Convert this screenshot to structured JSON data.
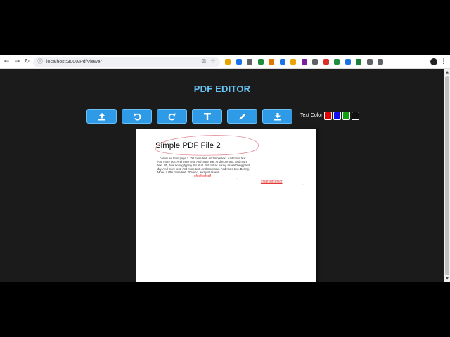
{
  "browser": {
    "url": "localhost:3000/PdfViewer",
    "nav": {
      "back": "←",
      "forward": "→",
      "reload": "↻"
    },
    "extension_colors": [
      "#e8a400",
      "#1a73e8",
      "#5f6368",
      "#1e8e3e",
      "#e37400",
      "#1a73e8",
      "#e8a400",
      "#7b1fa2",
      "#5f6368",
      "#d93025",
      "#1e8e3e",
      "#1a73e8",
      "#188038",
      "#5f6368",
      "#5f6368"
    ]
  },
  "app": {
    "title": "PDF EDITOR",
    "accent_color": "#69c3f2",
    "button_color": "#2f9be6",
    "toolbar": [
      {
        "name": "upload",
        "icon": "upload-icon"
      },
      {
        "name": "undo",
        "icon": "undo-icon"
      },
      {
        "name": "redo",
        "icon": "redo-icon"
      },
      {
        "name": "text",
        "icon": "text-icon"
      },
      {
        "name": "pencil",
        "icon": "pencil-icon"
      },
      {
        "name": "download",
        "icon": "download-icon"
      }
    ],
    "text_color_label": "Text Color:",
    "text_colors": [
      "#e00000",
      "#1010ee",
      "#11a011",
      "#111111"
    ]
  },
  "pdf": {
    "heading": "Simple PDF File 2",
    "body": "...continued from page 1. Yet more text. And more text. And more text. And more text. And more text. And more text. And more text. And more text. Oh, how boring typing this stuff. But not as boring as watching paint dry. And more text. And more text. And more text. And more text. Boring. More, a little more text. The end, and just as well.",
    "annotation_1": "sfsdfsdfsdf",
    "annotation_2": "sfsdfsdfsdfsdf",
    "annotation_color": "#e53935"
  }
}
